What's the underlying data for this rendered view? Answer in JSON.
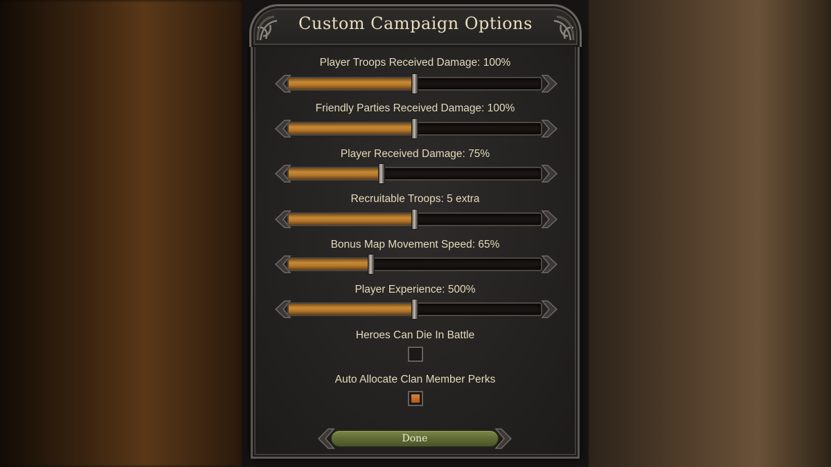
{
  "title": "Custom Campaign Options",
  "options": [
    {
      "label": "Player Troops Received Damage: 100%",
      "fraction": 0.5
    },
    {
      "label": "Friendly Parties Received Damage: 100%",
      "fraction": 0.5
    },
    {
      "label": "Player Received Damage: 75%",
      "fraction": 0.37
    },
    {
      "label": "Recruitable Troops: 5 extra",
      "fraction": 0.5
    },
    {
      "label": "Bonus Map Movement Speed: 65%",
      "fraction": 0.33
    },
    {
      "label": "Player Experience: 500%",
      "fraction": 0.5
    }
  ],
  "checkboxes": [
    {
      "label": "Heroes Can Die In Battle",
      "checked": false
    },
    {
      "label": "Auto Allocate Clan Member Perks",
      "checked": true
    }
  ],
  "done_label": "Done",
  "colors": {
    "fill": "#c58a36",
    "check": "#c86f2a",
    "done_button": "#6b763c"
  }
}
